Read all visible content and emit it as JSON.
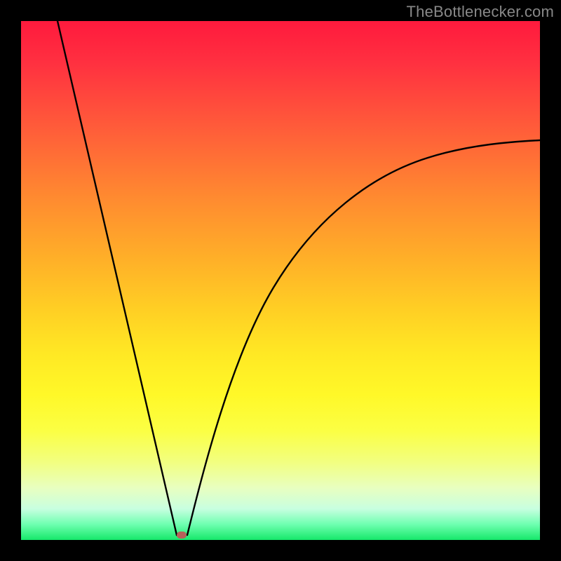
{
  "attribution": "TheBottlenecker.com",
  "marker": {
    "x_pct": 31.0,
    "y_pct": 99.0
  },
  "chart_data": {
    "type": "line",
    "title": "",
    "xlabel": "",
    "ylabel": "",
    "xlim": [
      0,
      100
    ],
    "ylim": [
      0,
      100
    ],
    "grid": false,
    "legend": false,
    "series": [
      {
        "name": "left-branch",
        "x": [
          7,
          10,
          13,
          16,
          19,
          22,
          25,
          27,
          29,
          30
        ],
        "y": [
          100,
          87,
          74,
          60,
          47,
          34,
          21,
          12,
          3,
          0
        ]
      },
      {
        "name": "right-branch",
        "x": [
          32,
          34,
          37,
          40,
          44,
          48,
          53,
          58,
          64,
          70,
          77,
          84,
          91,
          100
        ],
        "y": [
          0,
          10,
          22,
          31,
          40,
          47,
          53,
          58,
          63,
          67,
          70,
          73,
          75,
          77
        ]
      }
    ],
    "annotations": [
      {
        "type": "marker",
        "x": 31,
        "y": 1,
        "color": "#b8605a"
      }
    ],
    "background_gradient": {
      "direction": "vertical",
      "stops": [
        {
          "pct": 0,
          "color": "#ff1a3d"
        },
        {
          "pct": 50,
          "color": "#ffd024"
        },
        {
          "pct": 80,
          "color": "#fbff44"
        },
        {
          "pct": 100,
          "color": "#16e86a"
        }
      ]
    }
  }
}
